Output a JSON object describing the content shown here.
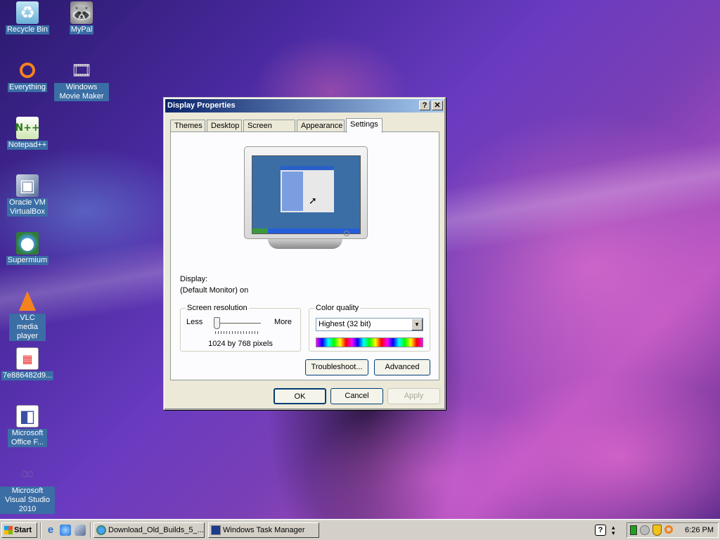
{
  "desktop": {
    "icons": [
      {
        "label": "Recycle Bin",
        "glyph": "recycle-bin-icon"
      },
      {
        "label": "MyPal",
        "glyph": "mypal-browser-icon"
      },
      {
        "label": "Everything",
        "glyph": "everything-search-icon"
      },
      {
        "label": "Windows Movie Maker",
        "glyph": "movie-maker-icon"
      },
      {
        "label": "Notepad++",
        "glyph": "notepad-plus-plus-icon"
      },
      {
        "label": "Oracle VM VirtualBox",
        "glyph": "virtualbox-icon"
      },
      {
        "label": "Supermium",
        "glyph": "supermium-browser-icon"
      },
      {
        "label": "VLC media player",
        "glyph": "vlc-cone-icon"
      },
      {
        "label": "7e886482d9...",
        "glyph": "image-file-icon"
      },
      {
        "label": "Microsoft Office F...",
        "glyph": "office-file-icon"
      },
      {
        "label": "Microsoft Visual Studio 2010",
        "glyph": "visual-studio-icon"
      }
    ]
  },
  "dialog": {
    "title": "Display Properties",
    "help_btn": "?",
    "close_btn": "✕",
    "tabs": [
      "Themes",
      "Desktop",
      "Screen Saver",
      "Appearance",
      "Settings"
    ],
    "active_tab": "Settings",
    "display_label": "Display:",
    "display_value": "(Default Monitor) on",
    "resolution": {
      "legend": "Screen resolution",
      "less": "Less",
      "more": "More",
      "value_text": "1024 by 768 pixels",
      "slider_position_fraction": 0.05
    },
    "color_quality": {
      "legend": "Color quality",
      "selected": "Highest (32 bit)"
    },
    "buttons": {
      "troubleshoot": "Troubleshoot...",
      "advanced": "Advanced",
      "ok": "OK",
      "cancel": "Cancel",
      "apply": "Apply"
    }
  },
  "taskbar": {
    "start_label": "Start",
    "items": [
      "Download_Old_Builds_5_...",
      "Windows Task Manager"
    ],
    "clock": "6:26 PM"
  },
  "colors": {
    "titlebar_start": "#0a246a",
    "titlebar_end": "#a6caf0",
    "label_bg": "#3a6ea5"
  }
}
